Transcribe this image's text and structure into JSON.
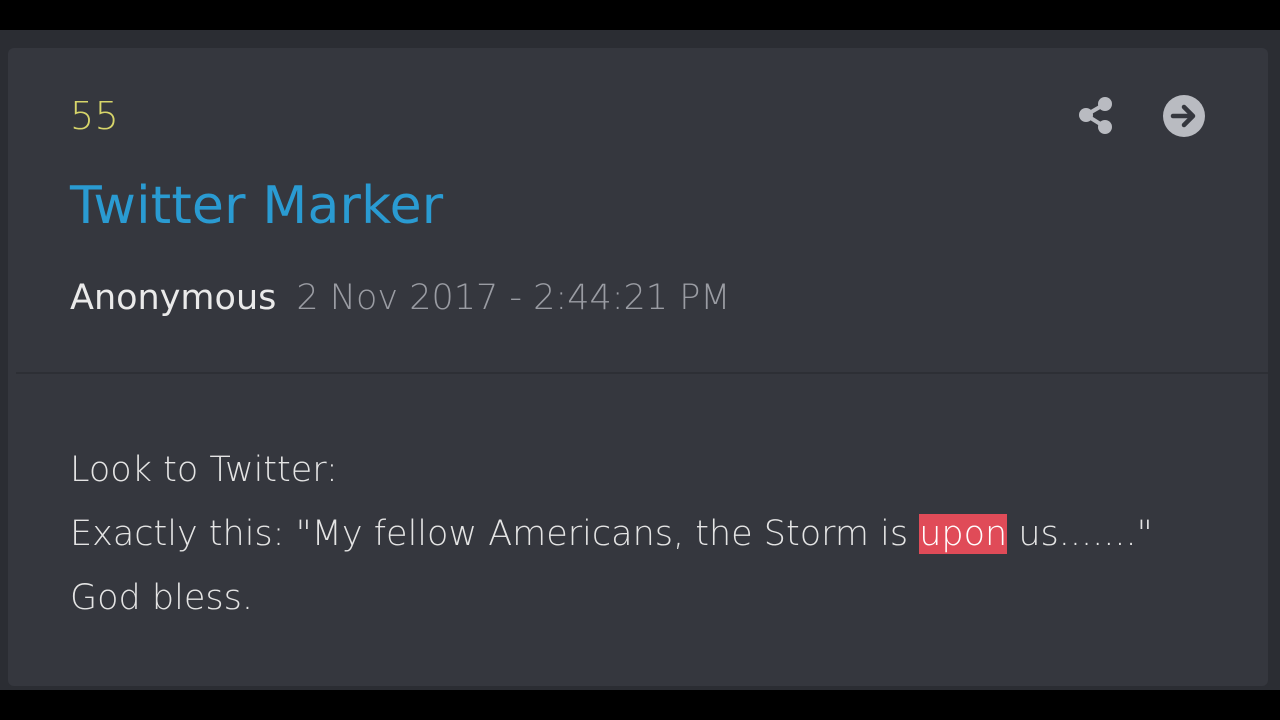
{
  "post": {
    "number": "55",
    "title": "Twitter Marker",
    "author": "Anonymous",
    "timestamp": "2 Nov 2017 - 2:44:21 PM",
    "body": {
      "line1": "Look to Twitter:",
      "line2_before": "Exactly this: \"My fellow Americans, the Storm is ",
      "line2_highlight": "upon",
      "line2_after": " us.......\"",
      "line3": "God bless."
    }
  },
  "actions": {
    "share_icon": "share-icon",
    "open_icon": "arrow-right-circle-icon"
  },
  "colors": {
    "number": "#d7d56a",
    "title": "#2a9bd2",
    "highlight": "#e04b58",
    "card": "#35373e"
  }
}
